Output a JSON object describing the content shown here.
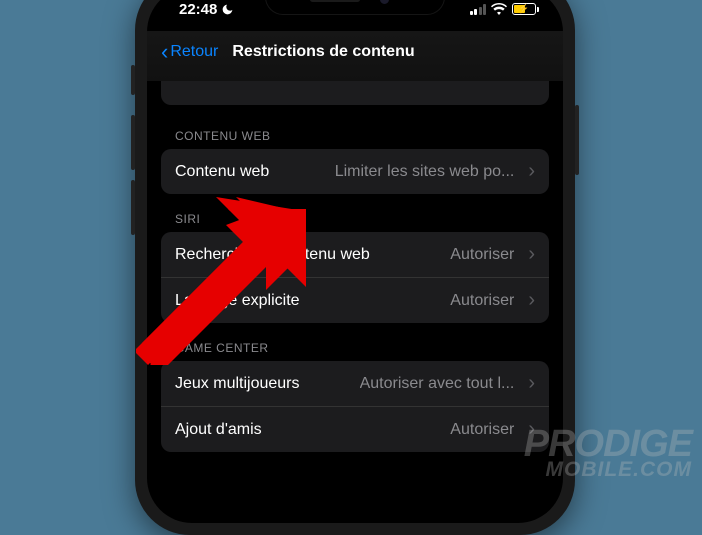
{
  "status": {
    "time": "22:48"
  },
  "nav": {
    "back": "Retour",
    "title": "Restrictions de contenu"
  },
  "sections": {
    "web": {
      "header": "CONTENU WEB",
      "rows": {
        "content": {
          "label": "Contenu web",
          "value": "Limiter les sites web po..."
        }
      }
    },
    "siri": {
      "header": "SIRI",
      "rows": {
        "search": {
          "label": "Recherche de contenu web",
          "value": "Autoriser"
        },
        "explicit": {
          "label": "Langage explicite",
          "value": "Autoriser"
        }
      }
    },
    "gamecenter": {
      "header": "GAME CENTER",
      "rows": {
        "multiplayer": {
          "label": "Jeux multijoueurs",
          "value": "Autoriser avec tout l..."
        },
        "addfriends": {
          "label": "Ajout d'amis",
          "value": "Autoriser"
        }
      }
    }
  },
  "watermark": {
    "line1": "PRODIGE",
    "line2": "MOBILE.COM"
  }
}
